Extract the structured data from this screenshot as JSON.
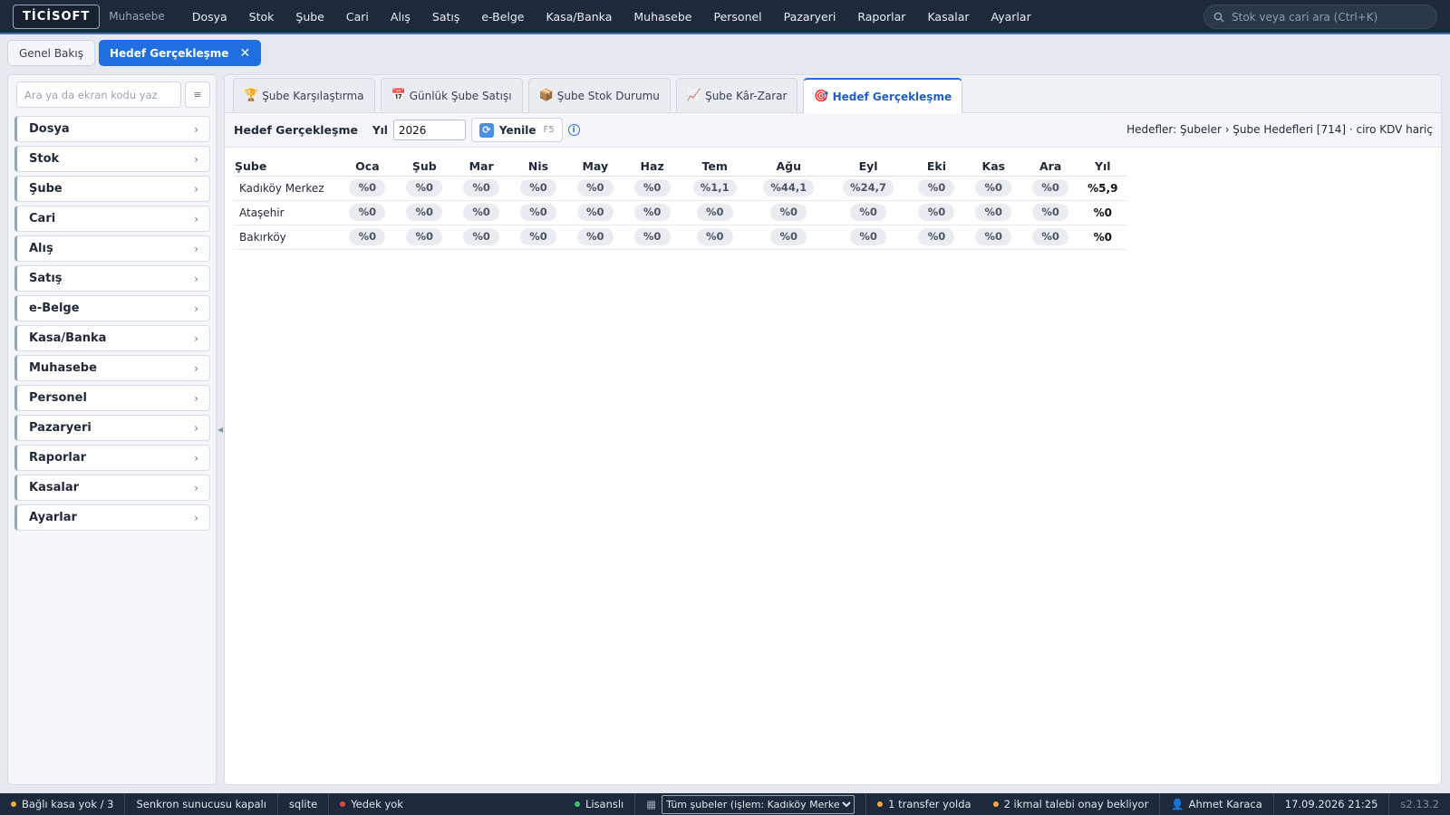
{
  "app": {
    "logo": "TİCİSOFT",
    "module": "Muhasebe",
    "menu": [
      "Dosya",
      "Stok",
      "Şube",
      "Cari",
      "Alış",
      "Satış",
      "e-Belge",
      "Kasa/Banka",
      "Muhasebe",
      "Personel",
      "Pazaryeri",
      "Raporlar",
      "Kasalar",
      "Ayarlar"
    ],
    "search_placeholder": "Stok veya cari ara (Ctrl+K)"
  },
  "page_tabs": {
    "inactive": "Genel Bakış",
    "active": "Hedef Gerçekleşme",
    "close": "✕"
  },
  "sidebar": {
    "search_placeholder": "Ara ya da ekran kodu yaz",
    "button": "≡",
    "items": [
      "Dosya",
      "Stok",
      "Şube",
      "Cari",
      "Alış",
      "Satış",
      "e-Belge",
      "Kasa/Banka",
      "Muhasebe",
      "Personel",
      "Pazaryeri",
      "Raporlar",
      "Kasalar",
      "Ayarlar"
    ]
  },
  "sub_tabs": [
    {
      "icon": "🏆",
      "icon_name": "trophy-icon",
      "label": "Şube Karşılaştırma"
    },
    {
      "icon": "📅",
      "icon_name": "calendar-icon",
      "label": "Günlük Şube Satışı"
    },
    {
      "icon": "📦",
      "icon_name": "package-icon",
      "label": "Şube Stok Durumu"
    },
    {
      "icon": "📈",
      "icon_name": "chart-up-icon",
      "label": "Şube Kâr-Zarar"
    },
    {
      "icon": "🎯",
      "icon_name": "target-icon",
      "label": "Hedef Gerçekleşme",
      "active": true
    }
  ],
  "toolbar": {
    "title": "Hedef Gerçekleşme",
    "year_label": "Yıl",
    "year_value": "2026",
    "refresh_label": "Yenile",
    "refresh_key": "F5",
    "info": "i",
    "source_text": "Hedefler: Şubeler › Şube Hedefleri [714] · ciro KDV hariç"
  },
  "table": {
    "columns": [
      "Şube",
      "Oca",
      "Şub",
      "Mar",
      "Nis",
      "May",
      "Haz",
      "Tem",
      "Ağu",
      "Eyl",
      "Eki",
      "Kas",
      "Ara",
      "Yıl"
    ],
    "rows": [
      {
        "branch": "Kadıköy Merkez",
        "months": [
          "%0",
          "%0",
          "%0",
          "%0",
          "%0",
          "%0",
          "%1,1",
          "%44,1",
          "%24,7",
          "%0",
          "%0",
          "%0"
        ],
        "year": "%5,9"
      },
      {
        "branch": "Ataşehir",
        "months": [
          "%0",
          "%0",
          "%0",
          "%0",
          "%0",
          "%0",
          "%0",
          "%0",
          "%0",
          "%0",
          "%0",
          "%0"
        ],
        "year": "%0"
      },
      {
        "branch": "Bakırköy",
        "months": [
          "%0",
          "%0",
          "%0",
          "%0",
          "%0",
          "%0",
          "%0",
          "%0",
          "%0",
          "%0",
          "%0",
          "%0"
        ],
        "year": "%0"
      }
    ]
  },
  "status": {
    "cash": "Bağlı kasa yok / 3",
    "sync": "Senkron sunucusu kapalı",
    "db": "sqlite",
    "backup": "Yedek yok",
    "license": "Lisanslı",
    "branch_select": "Tüm şubeler (işlem: Kadıköy Merkez)",
    "transfer": "1 transfer yolda",
    "supply": "2 ikmal talebi onay bekliyor",
    "user": "Ahmet Karaca",
    "datetime": "17.09.2026 21:25",
    "version": "s2.13.2"
  },
  "colors": {
    "topbar": "#1e2a3b",
    "accent": "#1f6fe0",
    "ok": "#35c46b",
    "warn": "#f2a93b",
    "danger": "#e04545"
  }
}
